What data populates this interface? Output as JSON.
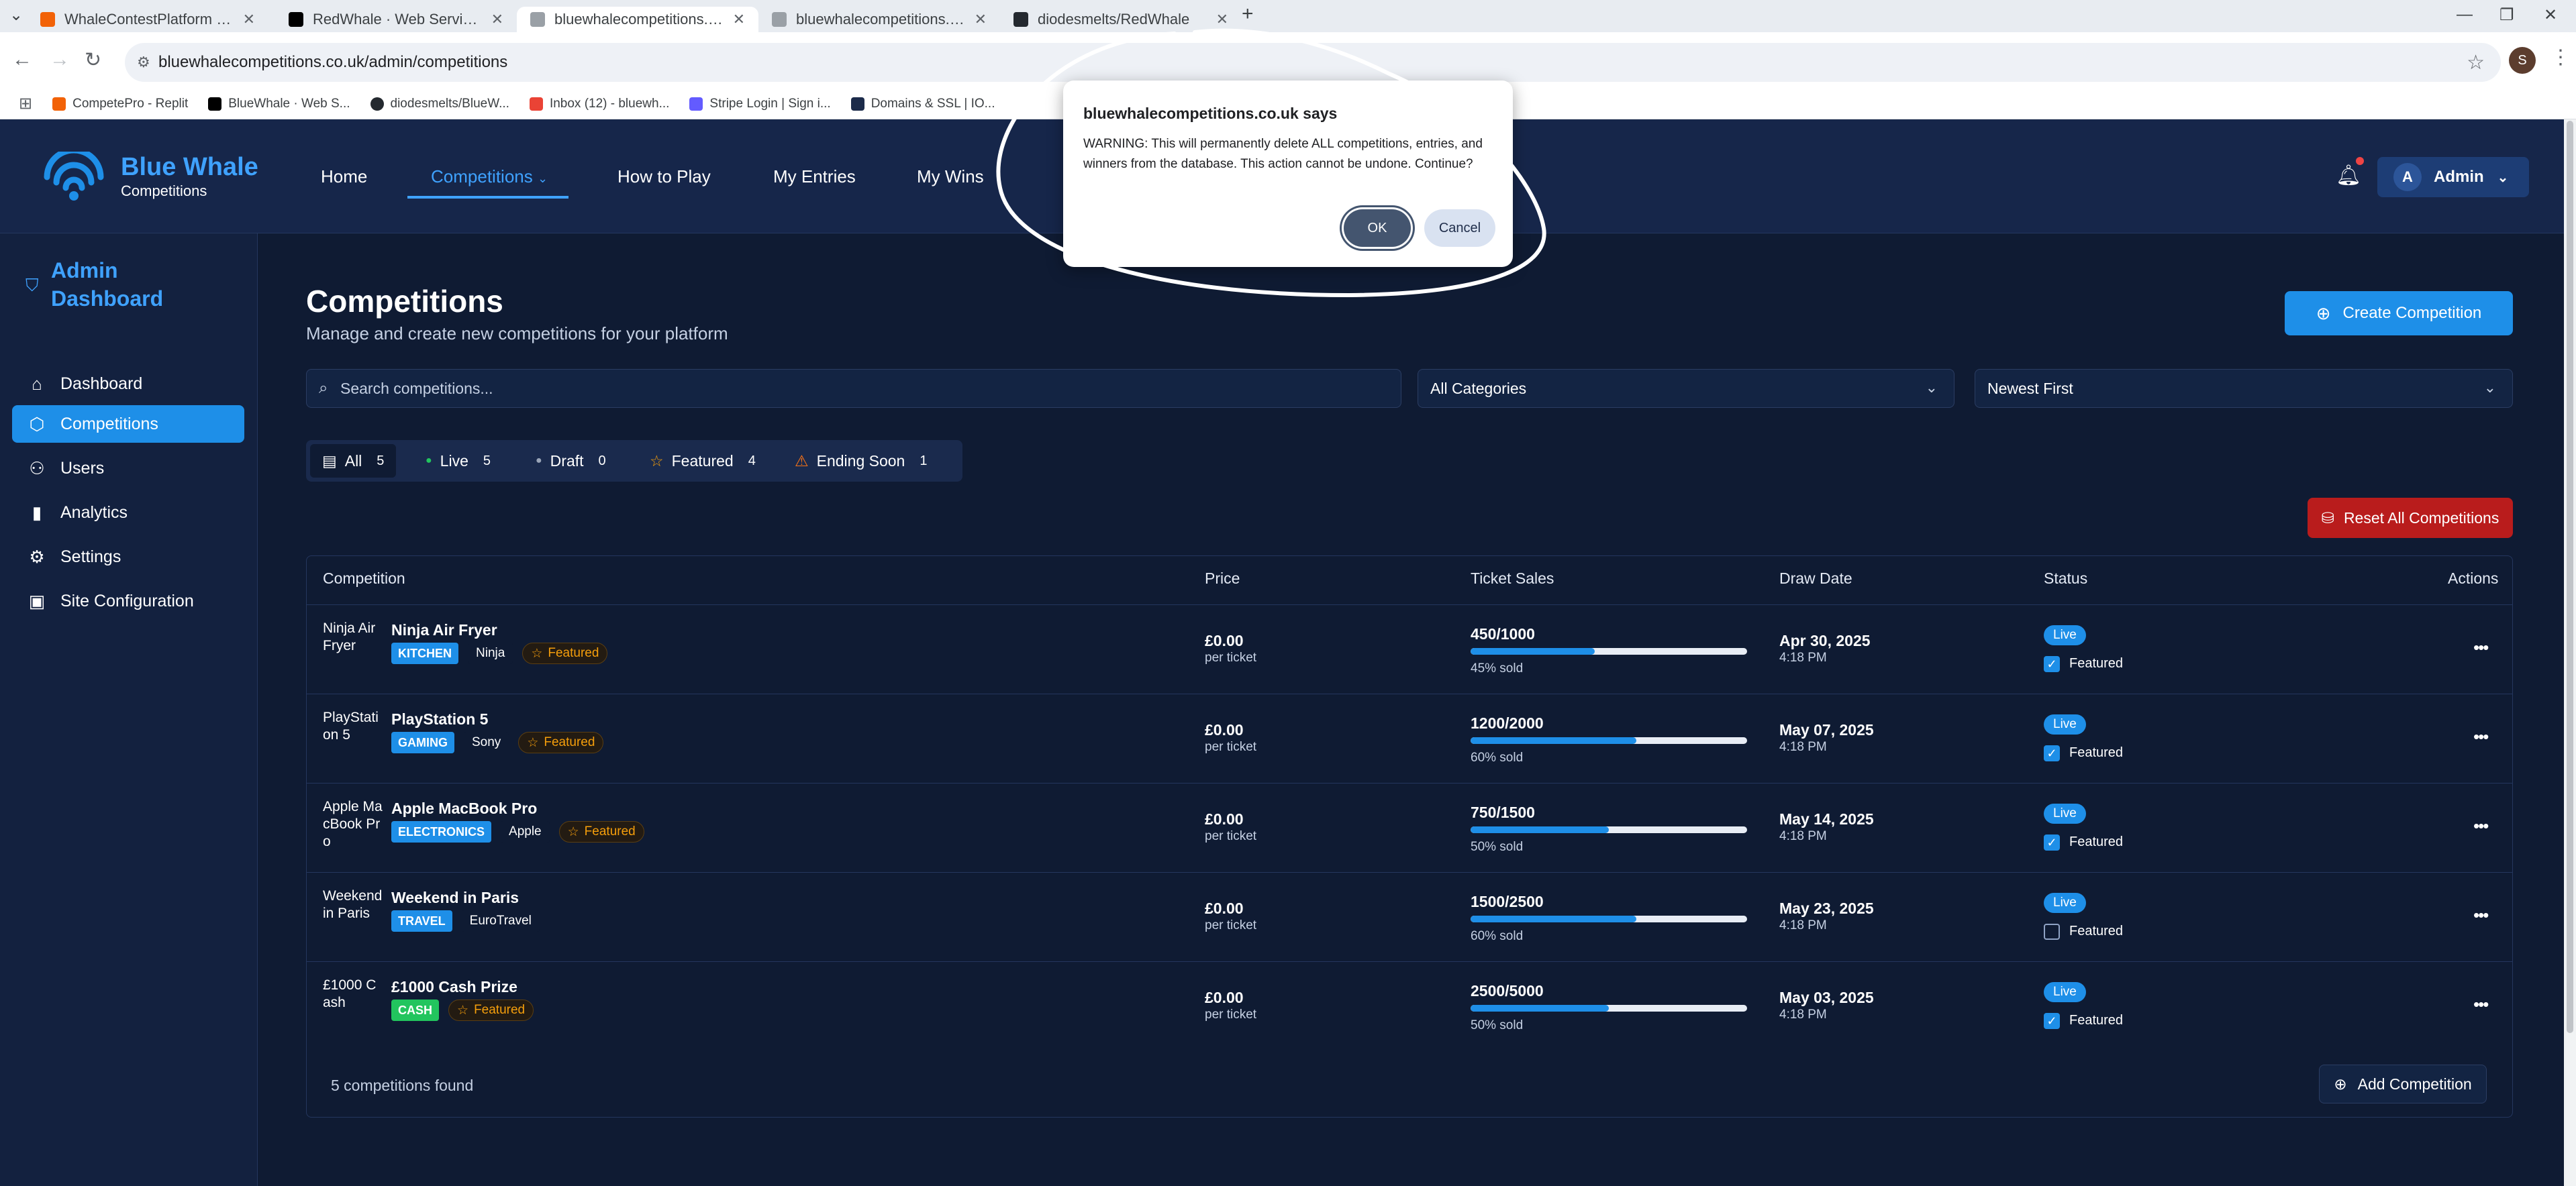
{
  "browser": {
    "tabs": [
      {
        "title": "WhaleContestPlatform - Replit"
      },
      {
        "title": "RedWhale · Web Service · Ren"
      },
      {
        "title": "bluewhalecompetitions.co.uk/ad"
      },
      {
        "title": "bluewhalecompetitions.co.uk/a"
      },
      {
        "title": "diodesmelts/RedWhale"
      }
    ],
    "url": "bluewhalecompetitions.co.uk/admin/competitions",
    "profile_initial": "S",
    "bookmarks": [
      {
        "label": "CompetePro - Replit",
        "color": "#f26207"
      },
      {
        "label": "BlueWhale · Web S...",
        "color": "#000000"
      },
      {
        "label": "diodesmelts/BlueW...",
        "color": "#24292f"
      },
      {
        "label": "Inbox (12) - bluewh...",
        "color": "#ea4335"
      },
      {
        "label": "Stripe Login | Sign i...",
        "color": "#635bff"
      },
      {
        "label": "Domains & SSL | IO...",
        "color": "#1c2b4a"
      }
    ]
  },
  "header": {
    "brand_name": "Blue Whale",
    "brand_sub": "Competitions",
    "nav": [
      "Home",
      "Competitions",
      "How to Play",
      "My Entries",
      "My Wins"
    ],
    "admin_initial": "A",
    "admin_label": "Admin"
  },
  "sidebar": {
    "title_line1": "Admin",
    "title_line2": "Dashboard",
    "items": [
      {
        "label": "Dashboard",
        "icon": "home-icon"
      },
      {
        "label": "Competitions",
        "icon": "package-icon"
      },
      {
        "label": "Users",
        "icon": "users-icon"
      },
      {
        "label": "Analytics",
        "icon": "bar-chart-icon"
      },
      {
        "label": "Settings",
        "icon": "gear-icon"
      },
      {
        "label": "Site Configuration",
        "icon": "image-icon"
      }
    ]
  },
  "page": {
    "title": "Competitions",
    "subtitle": "Manage and create new competitions for your platform",
    "create_button": "Create Competition",
    "search_placeholder": "Search competitions...",
    "category_select": "All Categories",
    "sort_select": "Newest First",
    "filters": [
      {
        "label": "All",
        "count": "5"
      },
      {
        "label": "Live",
        "count": "5"
      },
      {
        "label": "Draft",
        "count": "0"
      },
      {
        "label": "Featured",
        "count": "4"
      },
      {
        "label": "Ending Soon",
        "count": "1"
      }
    ],
    "reset_button": "Reset All Competitions",
    "columns": [
      "Competition",
      "Price",
      "Ticket Sales",
      "Draw Date",
      "Status",
      "Actions"
    ],
    "rows": [
      {
        "thumb_alt": "Ninja Air Fryer",
        "name": "Ninja Air Fryer",
        "category": "KITCHEN",
        "category_color": "#1e8fe8",
        "brand": "Ninja",
        "featured": "Featured",
        "price": "£0.00",
        "price_unit": "per ticket",
        "sales": "450/1000",
        "sold_fraction": 0.45,
        "sold_label": "45% sold",
        "date": "Apr 30, 2025",
        "time": "4:18 PM",
        "status": "Live",
        "featured_checked": true,
        "featured_label": "Featured"
      },
      {
        "thumb_alt": "PlayStation 5",
        "name": "PlayStation 5",
        "category": "GAMING",
        "category_color": "#1e8fe8",
        "brand": "Sony",
        "featured": "Featured",
        "price": "£0.00",
        "price_unit": "per ticket",
        "sales": "1200/2000",
        "sold_fraction": 0.6,
        "sold_label": "60% sold",
        "date": "May 07, 2025",
        "time": "4:18 PM",
        "status": "Live",
        "featured_checked": true,
        "featured_label": "Featured"
      },
      {
        "thumb_alt": "Apple MacBook Pro",
        "name": "Apple MacBook Pro",
        "category": "ELECTRONICS",
        "category_color": "#1e8fe8",
        "brand": "Apple",
        "featured": "Featured",
        "price": "£0.00",
        "price_unit": "per ticket",
        "sales": "750/1500",
        "sold_fraction": 0.5,
        "sold_label": "50% sold",
        "date": "May 14, 2025",
        "time": "4:18 PM",
        "status": "Live",
        "featured_checked": true,
        "featured_label": "Featured"
      },
      {
        "thumb_alt": "Weekend in Paris",
        "name": "Weekend in Paris",
        "category": "TRAVEL",
        "category_color": "#1e8fe8",
        "brand": "EuroTravel",
        "featured": "",
        "price": "£0.00",
        "price_unit": "per ticket",
        "sales": "1500/2500",
        "sold_fraction": 0.6,
        "sold_label": "60% sold",
        "date": "May 23, 2025",
        "time": "4:18 PM",
        "status": "Live",
        "featured_checked": false,
        "featured_label": "Featured"
      },
      {
        "thumb_alt": "£1000 Cash",
        "name": "£1000 Cash Prize",
        "category": "CASH",
        "category_color": "#22c55e",
        "brand": "",
        "featured": "Featured",
        "price": "£0.00",
        "price_unit": "per ticket",
        "sales": "2500/5000",
        "sold_fraction": 0.5,
        "sold_label": "50% sold",
        "date": "May 03, 2025",
        "time": "4:18 PM",
        "status": "Live",
        "featured_checked": true,
        "featured_label": "Featured"
      }
    ],
    "count_text": "5 competitions found",
    "add_button": "Add Competition"
  },
  "dialog": {
    "title": "bluewhalecompetitions.co.uk says",
    "message": "WARNING: This will permanently delete ALL competitions, entries, and winners from the database. This action cannot be undone. Continue?",
    "ok": "OK",
    "cancel": "Cancel"
  }
}
